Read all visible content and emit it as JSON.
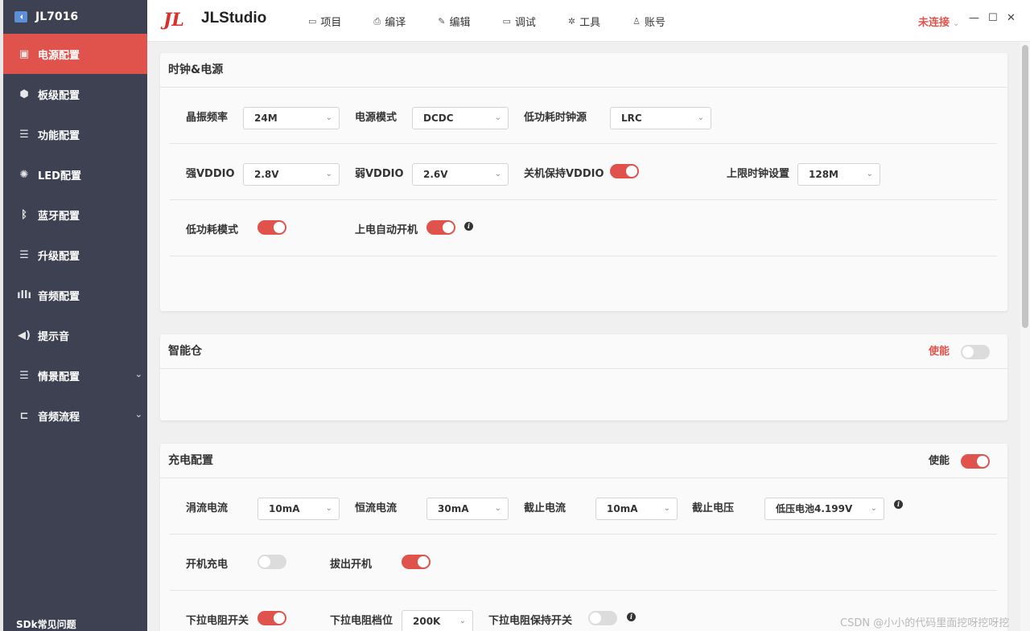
{
  "sidebar": {
    "device": "JL7016",
    "items": [
      {
        "label": "电源配置",
        "icon": "power-board-icon",
        "glyph": "▣"
      },
      {
        "label": "板级配置",
        "icon": "cube-icon",
        "glyph": "⬢"
      },
      {
        "label": "功能配置",
        "icon": "list-icon",
        "glyph": "☰"
      },
      {
        "label": "LED配置",
        "icon": "bulb-icon",
        "glyph": "✺"
      },
      {
        "label": "蓝牙配置",
        "icon": "bluetooth-icon",
        "glyph": "ᛒ"
      },
      {
        "label": "升级配置",
        "icon": "list-icon",
        "glyph": "☰"
      },
      {
        "label": "音频配置",
        "icon": "audio-wave-icon",
        "glyph": "ıllı"
      },
      {
        "label": "提示音",
        "icon": "speaker-icon",
        "glyph": "◀)"
      },
      {
        "label": "情景配置",
        "icon": "list-icon",
        "glyph": "☰"
      },
      {
        "label": "音频流程",
        "icon": "flow-icon",
        "glyph": "⊏"
      }
    ],
    "footer": "SDk常见问题"
  },
  "topbar": {
    "brand": "JLStudio",
    "menu": [
      {
        "label": "项目",
        "icon": "folder-icon",
        "glyph": "▭"
      },
      {
        "label": "编译",
        "icon": "printer-icon",
        "glyph": "⎙"
      },
      {
        "label": "编辑",
        "icon": "pen-icon",
        "glyph": "✎"
      },
      {
        "label": "调试",
        "icon": "monitor-icon",
        "glyph": "▭"
      },
      {
        "label": "工具",
        "icon": "tools-icon",
        "glyph": "✲"
      },
      {
        "label": "账号",
        "icon": "user-icon",
        "glyph": "♙"
      }
    ],
    "status": "未连接"
  },
  "clock_power": {
    "title": "时钟&电源",
    "osc_freq_label": "晶振频率",
    "osc_freq": "24M",
    "power_mode_label": "电源模式",
    "power_mode": "DCDC",
    "lp_clock_label": "低功耗时钟源",
    "lp_clock": "LRC",
    "strong_vddio_label": "强VDDIO",
    "strong_vddio": "2.8V",
    "weak_vddio_label": "弱VDDIO",
    "weak_vddio": "2.6V",
    "keep_vddio_label": "关机保持VDDIO",
    "keep_vddio": true,
    "max_clock_label": "上限时钟设置",
    "max_clock": "128M",
    "lp_mode_label": "低功耗模式",
    "lp_mode": true,
    "auto_on_label": "上电自动开机",
    "auto_on": true
  },
  "smart_box": {
    "title": "智能仓",
    "enable_label": "使能",
    "enabled": false
  },
  "charge": {
    "title": "充电配置",
    "enable_label": "使能",
    "enabled": true,
    "trickle_label": "涓流电流",
    "trickle": "10mA",
    "const_label": "恒流电流",
    "const": "30mA",
    "cutoff_i_label": "截止电流",
    "cutoff_i": "10mA",
    "cutoff_v_label": "截止电压",
    "cutoff_v": "低压电池4.199V",
    "power_on_charge_label": "开机充电",
    "power_on_charge": false,
    "unplug_on_label": "拔出开机",
    "unplug_on": true,
    "pulldown_label": "下拉电阻开关",
    "pulldown": true,
    "pulldown_level_label": "下拉电阻档位",
    "pulldown_level": "200K",
    "pulldown_keep_label": "下拉电阻保持开关",
    "pulldown_keep": false
  },
  "watermark": "CSDN @小小的代码里面挖呀挖呀挖",
  "colors": {
    "accent": "#e0524c",
    "sidebar": "#3d4152"
  }
}
